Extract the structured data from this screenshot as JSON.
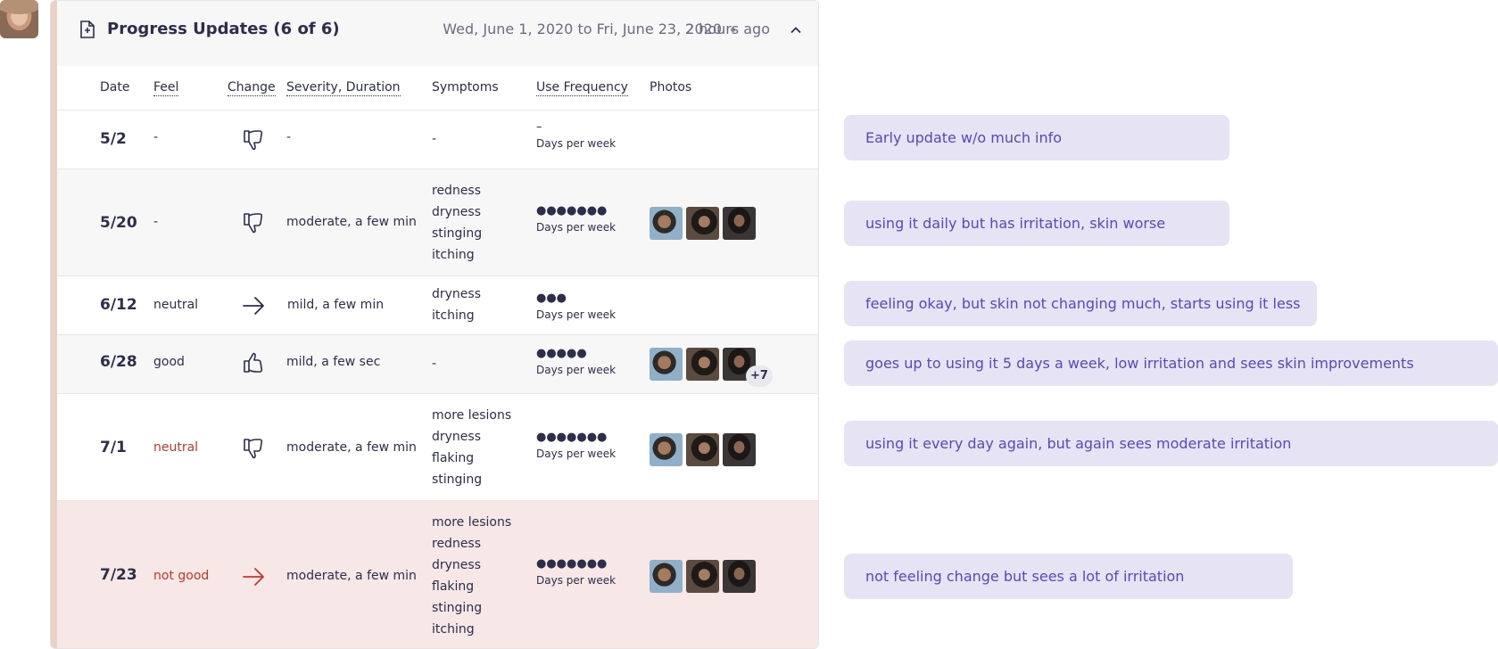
{
  "header": {
    "title": "Progress Updates (6 of 6)",
    "date_range": "Wed, June 1, 2020 to Fri, June 23, 2020",
    "updated": "2 hours ago"
  },
  "columns": [
    "Date",
    "Feel",
    "Change",
    "Severity, Duration",
    "Symptoms",
    "Use Frequency",
    "Photos"
  ],
  "rows": [
    {
      "date": "5/2",
      "feel": "-",
      "change": "thumbs-down",
      "severity": "-",
      "symptoms": [
        "-"
      ],
      "freq_dots": "–",
      "freq_label": "Days per week",
      "photos": false,
      "extra": ""
    },
    {
      "date": "5/20",
      "feel": "-",
      "change": "thumbs-down",
      "severity": "moderate, a few min",
      "symptoms": [
        "redness",
        "dryness",
        "stinging",
        "itching"
      ],
      "freq_dots": "●●●●●●●",
      "freq_label": "Days per week",
      "photos": true,
      "extra": ""
    },
    {
      "date": "6/12",
      "feel": "neutral",
      "change": "arrow-right",
      "severity": "mild, a few min",
      "symptoms": [
        "dryness",
        "itching"
      ],
      "freq_dots": "●●●",
      "freq_label": "Days per week",
      "photos": false,
      "extra": ""
    },
    {
      "date": "6/28",
      "feel": "good",
      "change": "thumbs-up",
      "severity": "mild, a few sec",
      "symptoms": [
        "-"
      ],
      "freq_dots": "●●●●●",
      "freq_label": "Days per week",
      "photos": true,
      "extra": "+7"
    },
    {
      "date": "7/1",
      "feel": "neutral",
      "change": "thumbs-down",
      "severity": "moderate, a few min",
      "symptoms": [
        "more lesions",
        "dryness",
        "flaking",
        "stinging"
      ],
      "freq_dots": "●●●●●●●",
      "freq_label": "Days per week",
      "photos": true,
      "extra": ""
    },
    {
      "date": "7/23",
      "feel": "not good",
      "change": "arrow-right",
      "severity": "moderate, a few min",
      "symptoms": [
        "more lesions",
        "redness",
        "dryness",
        "flaking",
        "stinging",
        "itching"
      ],
      "freq_dots": "●●●●●●●",
      "freq_label": "Days per week",
      "photos": true,
      "extra": ""
    }
  ],
  "notes": [
    "Early update w/o much info",
    "using it daily but has irritation, skin worse",
    "feeling okay, but skin not changing much, starts using it less",
    "goes up to using it 5 days a week, low irritation and sees skin improvements",
    "using it every day again, but again sees moderate irritation",
    "not feeling change but sees a lot of irritation"
  ],
  "colors": {
    "accent_red": "#c0392b",
    "note_bg": "#e6e4f4",
    "note_text": "#5a48b8",
    "highlight_row": "#f7e7e6"
  }
}
